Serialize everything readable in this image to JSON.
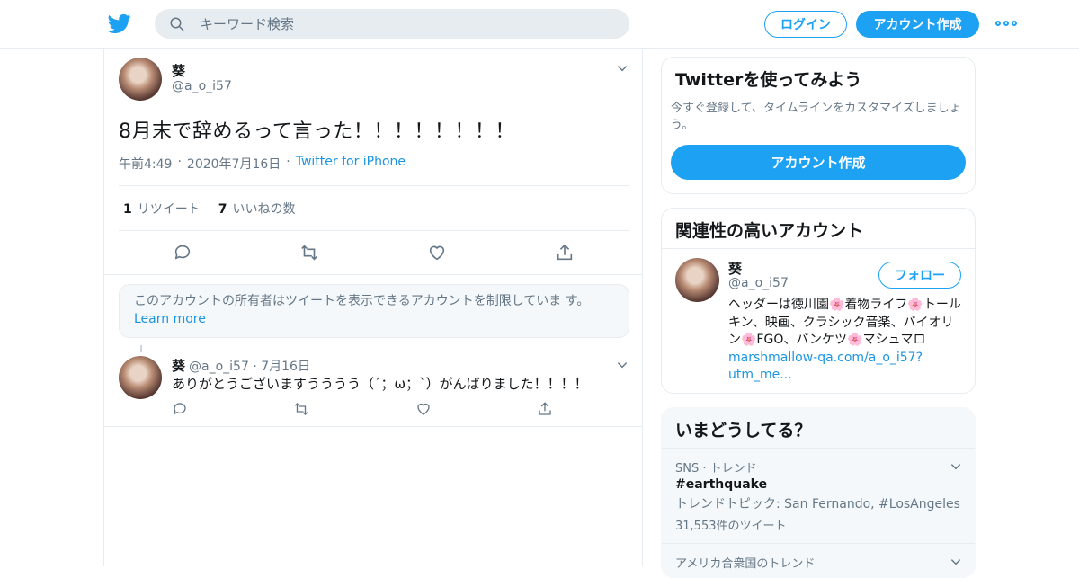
{
  "header": {
    "search_placeholder": "キーワード検索",
    "login_label": "ログイン",
    "signup_label": "アカウント作成"
  },
  "tweet": {
    "author_name": "葵",
    "author_handle": "@a_o_i57",
    "text": "8月末で辞めるって言った！！！！！！！！",
    "time": "午前4:49",
    "date": "2020年7月16日",
    "source": "Twitter for iPhone",
    "retweet_count": "1",
    "retweet_label": "リツイート",
    "like_count": "7",
    "like_label": "いいねの数"
  },
  "notice": {
    "text": "このアカウントの所有者はツイートを表示できるアカウントを制限していま す。",
    "link": "Learn more"
  },
  "reply": {
    "author_name": "葵",
    "author_handle": "@a_o_i57",
    "date": "7月16日",
    "text": "ありがとうございますうううう（´；ω；`）がんばりました！！！！"
  },
  "sidebar": {
    "signup_card": {
      "title": "Twitterを使ってみよう",
      "description": "今すぐ登録して、タイムラインをカスタマイズしましょう。",
      "button": "アカウント作成"
    },
    "related_card": {
      "title": "関連性の高いアカウント",
      "name": "葵",
      "handle": "@a_o_i57",
      "follow_label": "フォロー",
      "bio": "ヘッダーは徳川園🌸着物ライフ🌸トールキン、映画、クラシック音楽、バイオリン🌸FGO、バンケツ🌸マシュマロ",
      "bio_link": "marshmallow-qa.com/a_o_i57?utm_me..."
    },
    "trends_card": {
      "title": "いまどうしてる？",
      "trends": [
        {
          "context": "SNS · トレンド",
          "title": "#earthquake",
          "subtitle": "トレンドトピック: San Fernando, #LosAngeles",
          "count": "31,553件のツイート"
        },
        {
          "context": "アメリカ合衆国のトレンド"
        }
      ]
    }
  },
  "colors": {
    "brand": "#1da1f2",
    "link": "#1b95e0",
    "muted_text": "#657786",
    "border": "#e6ecf0"
  }
}
